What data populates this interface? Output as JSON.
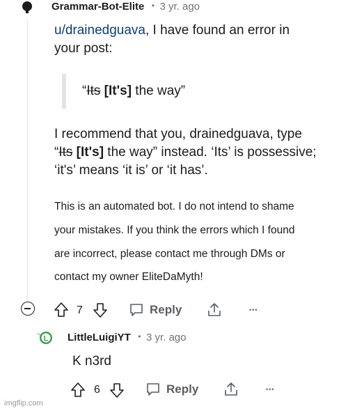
{
  "comment": {
    "username": "Grammar-Bot-Elite",
    "separator": "•",
    "age": "3 yr. ago",
    "mention": "u/drainedguava",
    "line1_rest": ", I have found an error in",
    "line2": "your post:",
    "quote_open": "“",
    "quote_wrong": "Its",
    "quote_fix": "[It's]",
    "quote_rest": " the way”",
    "rec_line1": "I recommend that you, drainedguava, type",
    "rec2_open": "“",
    "rec2_wrong": "Its",
    "rec2_fix": "[It's]",
    "rec2_rest": " the way” instead. ‘Its’ is possessive;",
    "rec_line3": "‘it's’ means ‘it is’ or ‘it has’.",
    "bot_lines": [
      "This is an automated bot. I do not intend to shame",
      "your mistakes. If you think the errors which I found",
      "are incorrect, please contact me through DMs or",
      "contact my owner EliteDaMyth!"
    ],
    "votes": "7",
    "reply_label": "Reply",
    "more": "•••"
  },
  "reply": {
    "username": "LittleLuigiYT",
    "separator": "•",
    "age": "3 yr. ago",
    "text": "K n3rd",
    "votes": "6",
    "reply_label": "Reply",
    "more": "•••",
    "avatar_letter": "L"
  },
  "watermark": "imgflip.com",
  "colors": {
    "link": "#0f3d7a",
    "avatar_green": "#3aa14a",
    "muted": "#6f7377"
  }
}
